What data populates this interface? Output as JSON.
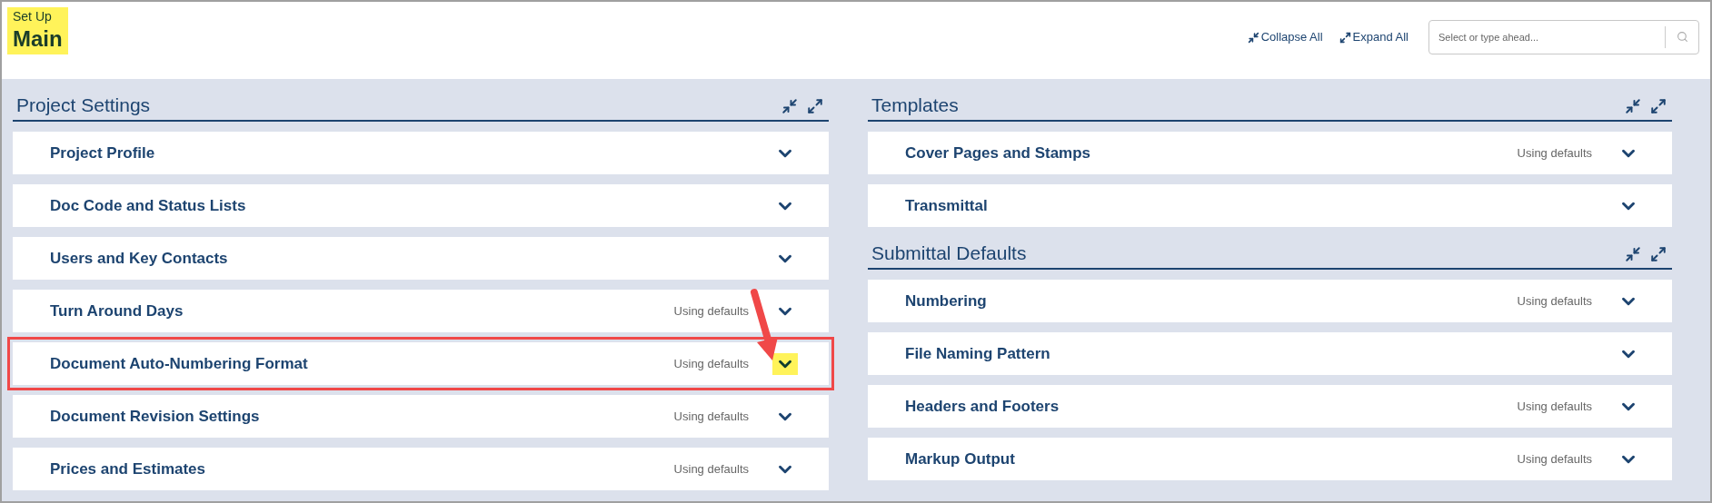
{
  "header": {
    "breadcrumb": "Set Up",
    "title": "Main",
    "highlighted": true
  },
  "toolbar": {
    "collapse_all": "Collapse All",
    "expand_all": "Expand All",
    "search": {
      "placeholder": "Select or type ahead..."
    }
  },
  "columns": [
    {
      "sections": [
        {
          "title": "Project Settings",
          "items": [
            {
              "label": "Project Profile",
              "annotated": false
            },
            {
              "label": "Doc Code and Status Lists",
              "annotated": false
            },
            {
              "label": "Users and Key Contacts",
              "annotated": false
            },
            {
              "label": "Turn Around Days",
              "status": "Using defaults",
              "annotated": false
            },
            {
              "label": "Document Auto-Numbering Format",
              "status": "Using defaults",
              "annotated": true
            },
            {
              "label": "Document Revision Settings",
              "status": "Using defaults",
              "annotated": false
            },
            {
              "label": "Prices and Estimates",
              "status": "Using defaults",
              "annotated": false
            }
          ]
        }
      ]
    },
    {
      "sections": [
        {
          "title": "Templates",
          "items": [
            {
              "label": "Cover Pages and Stamps",
              "status": "Using defaults",
              "annotated": false
            },
            {
              "label": "Transmittal",
              "annotated": false
            }
          ]
        },
        {
          "title": "Submittal Defaults",
          "items": [
            {
              "label": "Numbering",
              "status": "Using defaults",
              "annotated": false
            },
            {
              "label": "File Naming Pattern",
              "annotated": false
            },
            {
              "label": "Headers and Footers",
              "status": "Using defaults",
              "annotated": false
            },
            {
              "label": "Markup Output",
              "status": "Using defaults",
              "annotated": false
            }
          ]
        }
      ]
    }
  ]
}
